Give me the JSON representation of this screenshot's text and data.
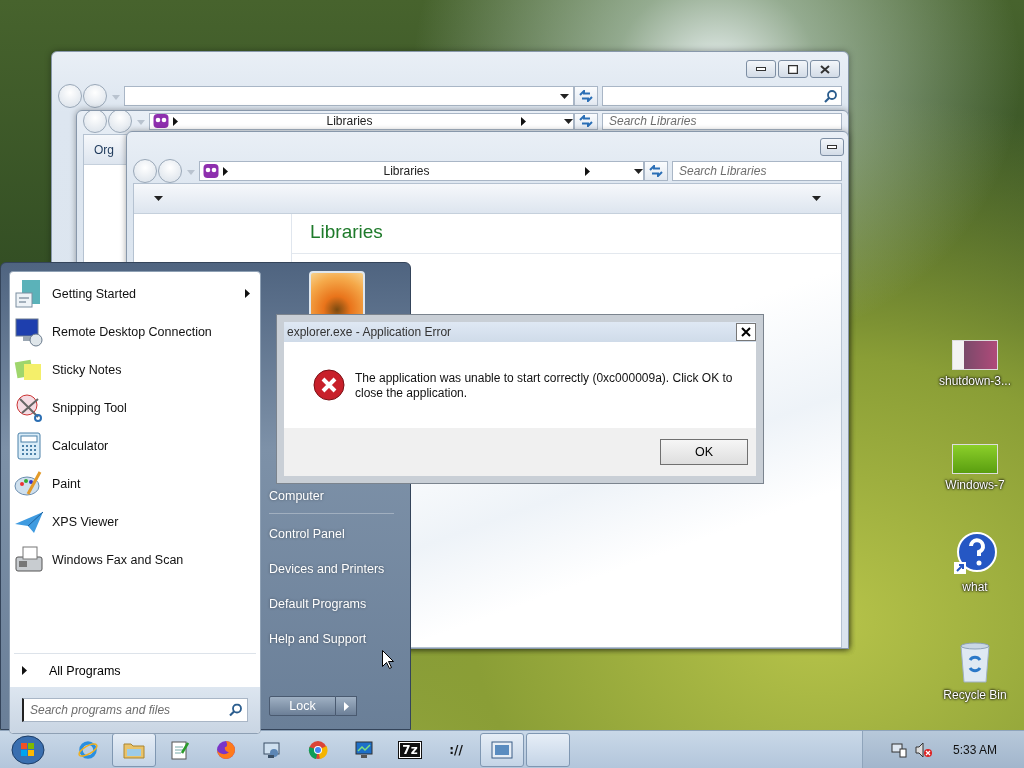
{
  "middle_window": {
    "breadcrumb": "Libraries",
    "search_placeholder": "Search Libraries",
    "toolbar_button": "Org"
  },
  "front_window": {
    "breadcrumb": "Libraries",
    "search_placeholder": "Search Libraries",
    "heading": "Libraries"
  },
  "start_menu": {
    "programs": [
      {
        "label": "Getting Started",
        "submenu": true
      },
      {
        "label": "Remote Desktop Connection",
        "submenu": false
      },
      {
        "label": "Sticky Notes",
        "submenu": false
      },
      {
        "label": "Snipping Tool",
        "submenu": false
      },
      {
        "label": "Calculator",
        "submenu": false
      },
      {
        "label": "Paint",
        "submenu": false
      },
      {
        "label": "XPS Viewer",
        "submenu": false
      },
      {
        "label": "Windows Fax and Scan",
        "submenu": false
      }
    ],
    "all_programs": "All Programs",
    "search_placeholder": "Search programs and files",
    "places": [
      {
        "label": "Computer",
        "divider_after": true
      },
      {
        "label": "Control Panel",
        "divider_after": false
      },
      {
        "label": "Devices and Printers",
        "divider_after": false
      },
      {
        "label": "Default Programs",
        "divider_after": false
      },
      {
        "label": "Help and Support",
        "divider_after": false
      }
    ],
    "shutdown_button": "Lock"
  },
  "dialog": {
    "title": "explorer.exe - Application Error",
    "message": "The application was unable to start correctly (0xc000009a). Click OK to close the application.",
    "button": "OK"
  },
  "desktop_icons": [
    {
      "label": "shutdown-3..."
    },
    {
      "label": "Windows-7"
    },
    {
      "label": "what"
    },
    {
      "label": "Recycle Bin"
    }
  ],
  "taskbar": {
    "buttons": [
      {
        "running": false
      },
      {
        "running": true
      },
      {
        "running": false
      },
      {
        "running": false
      },
      {
        "running": false
      },
      {
        "running": false
      },
      {
        "running": false
      },
      {
        "running": false,
        "glyph": "7z"
      },
      {
        "running": false,
        "glyph": "://"
      },
      {
        "running": true
      },
      {
        "running": true
      }
    ],
    "clock": "5:33 AM"
  }
}
